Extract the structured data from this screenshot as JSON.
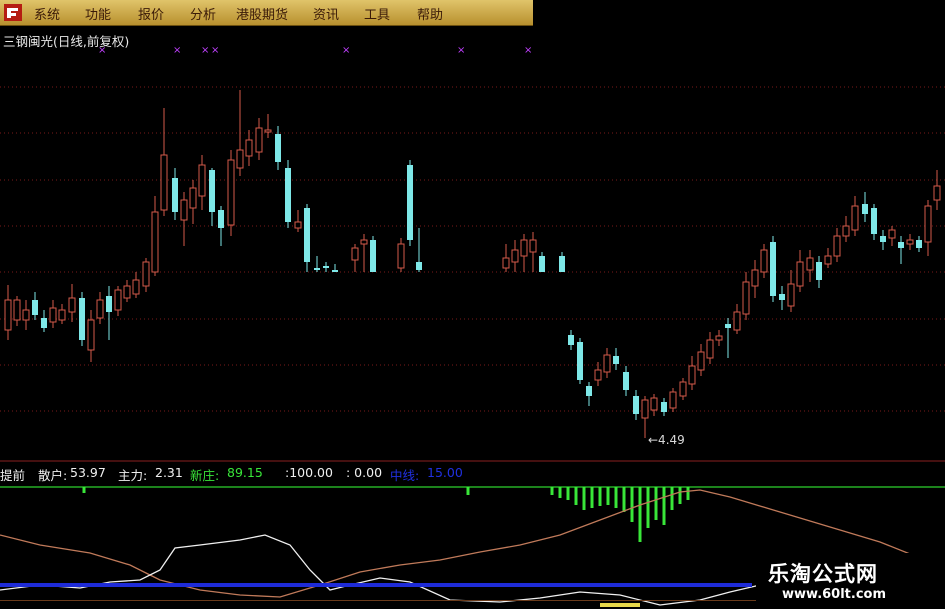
{
  "menu": {
    "items": [
      "系统",
      "功能",
      "报价",
      "分析",
      "港股期货",
      "资讯",
      "工具",
      "帮助"
    ]
  },
  "stock": {
    "title": "三钢闽光(日线,前复权)",
    "low_label": "←4.49"
  },
  "indicator": {
    "name": "提前",
    "retail_label": "散户:",
    "retail_value": "53.97",
    "main_label": "主力:",
    "main_value": "2.31",
    "new_label": "新庄:",
    "new_value": "89.15",
    "extra1": ":100.00",
    "extra2": ": 0.00",
    "mid_label": "中线:",
    "mid_value": "15.00"
  },
  "watermark": {
    "name": "乐淘公式网",
    "url": "www.60lt.com"
  },
  "colors": {
    "background": "#000000",
    "up_candle": "#d45a4a",
    "down_candle": "#7ee8e8",
    "green_bar": "#39e639",
    "blue_line": "#1e2bd8",
    "menu_bg": "#d2b24e",
    "signal_marker": "#c040ff"
  },
  "icons": {
    "logo": "app-logo-icon"
  },
  "chart_data": {
    "type": "candlestick",
    "title": "三钢闽光(日线,前复权)",
    "low_annotation": "4.49",
    "indicator": {
      "type": "bar+line",
      "series_values": {
        "散户": 53.97,
        "主力": 2.31,
        "新庄": 89.15,
        "中线": 15.0
      }
    }
  }
}
